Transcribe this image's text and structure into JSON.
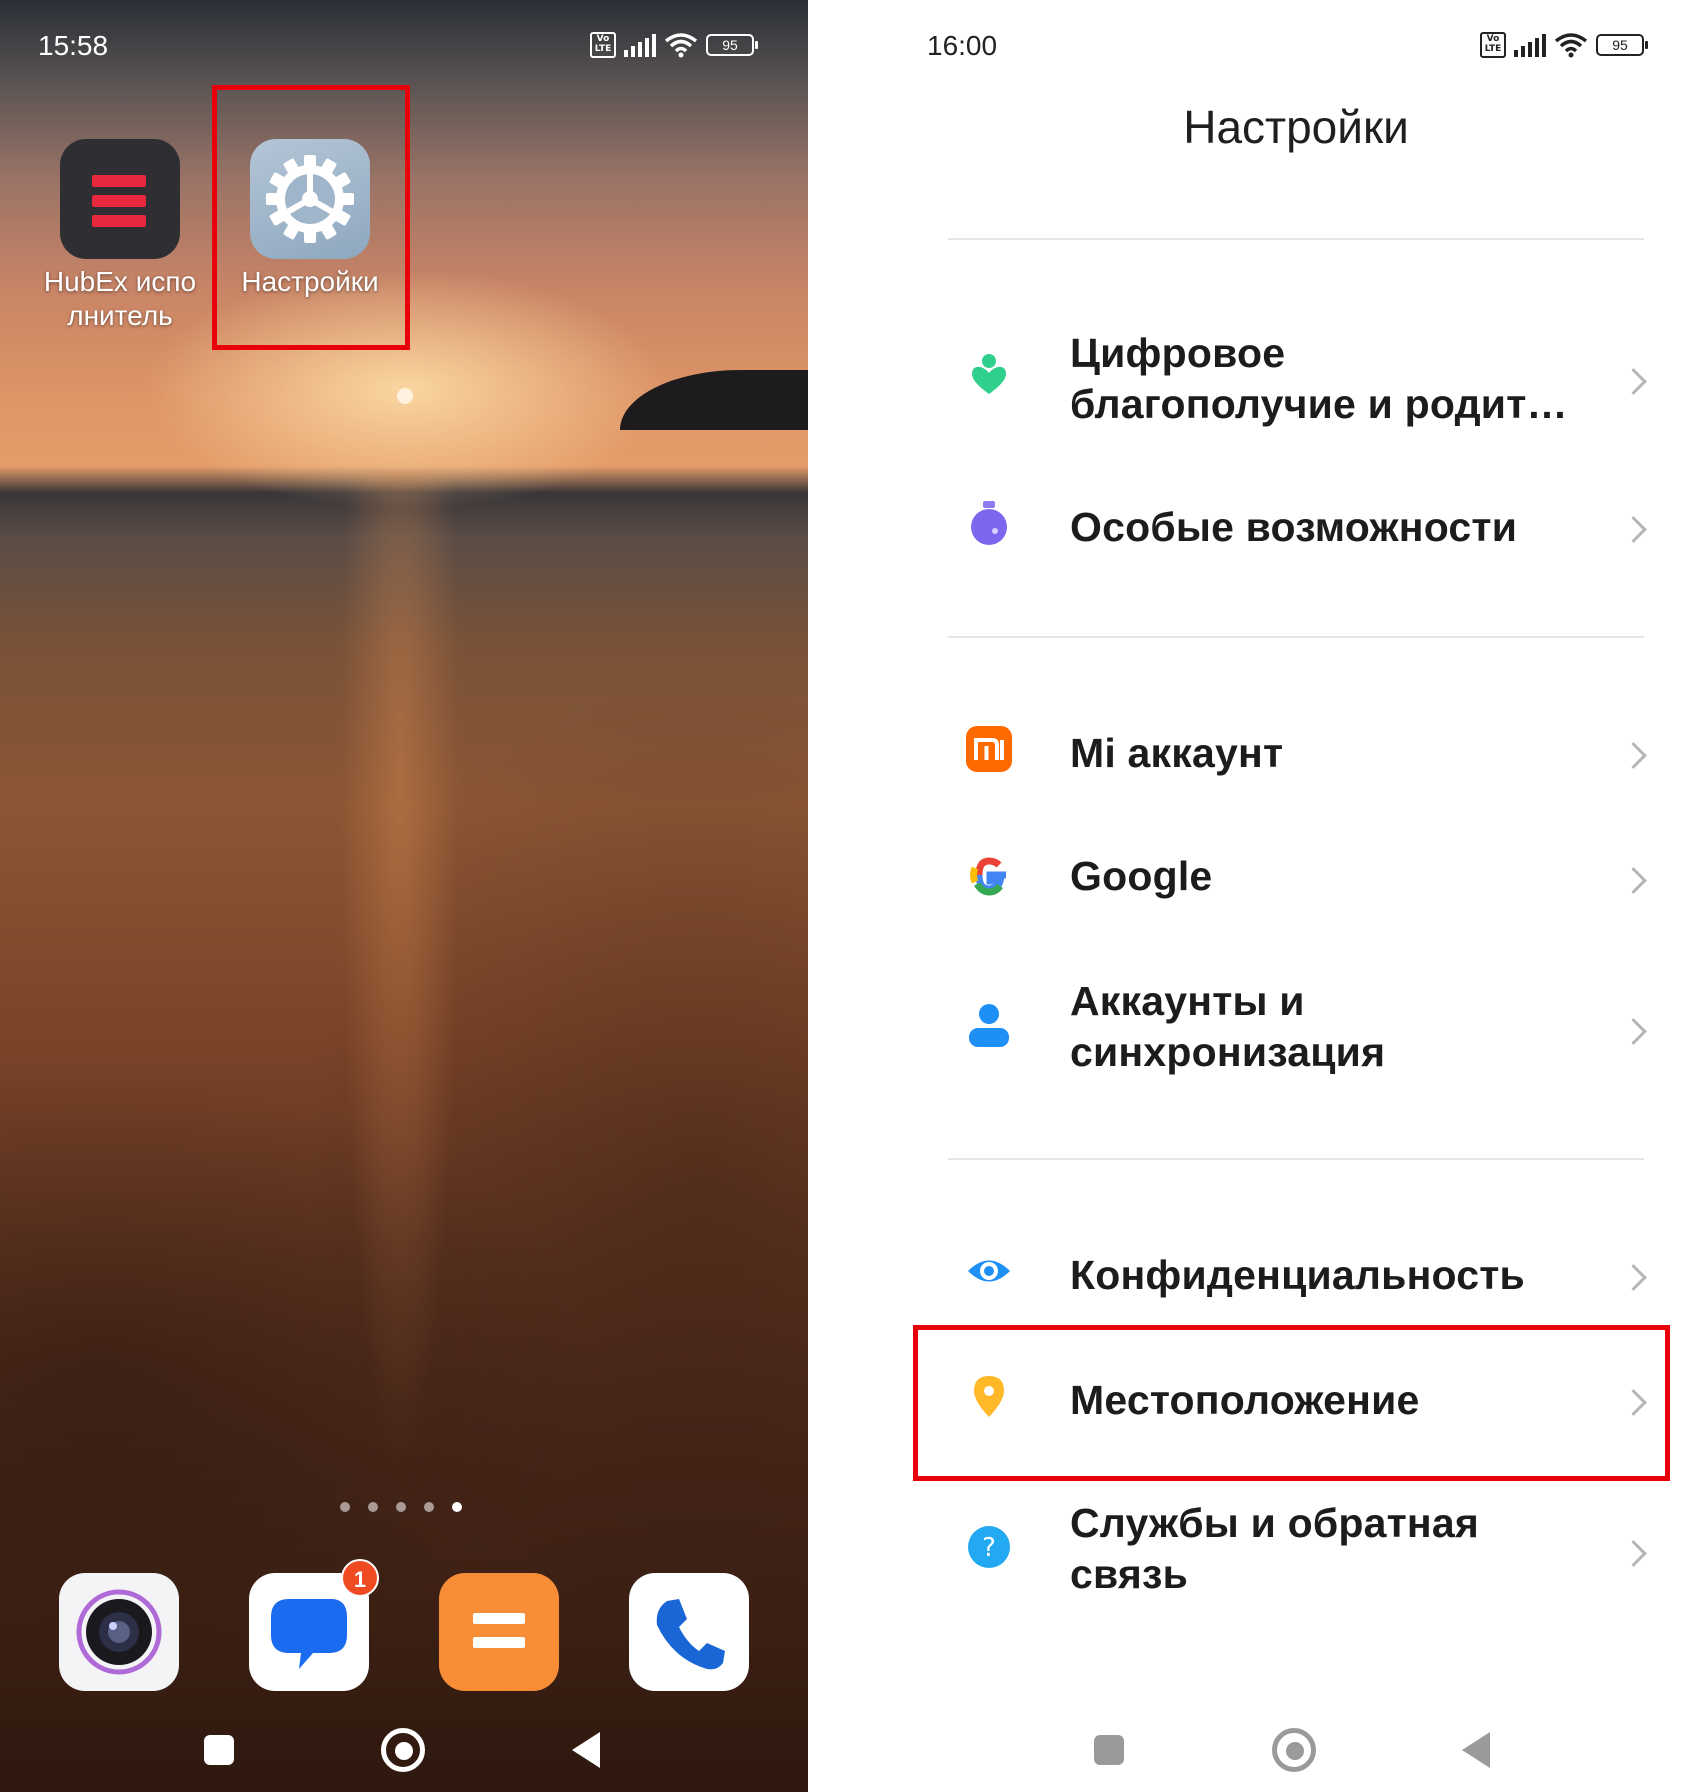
{
  "colors": {
    "highlight": "#e8000b",
    "hubex_red": "#e8283c",
    "badge": "#f04a23"
  },
  "left_phone": {
    "status": {
      "time": "15:58",
      "lte": "Vo LTE",
      "battery": "95"
    },
    "apps": [
      {
        "label": "HubEx испо лнитель",
        "icon": "hubex-icon"
      },
      {
        "label": "Настройки",
        "icon": "settings-gear-icon"
      }
    ],
    "page_dots": {
      "count": 5,
      "active": 5
    },
    "dock": [
      {
        "icon": "camera-icon"
      },
      {
        "icon": "messages-icon",
        "badge": "1"
      },
      {
        "icon": "orange-equals-icon"
      },
      {
        "icon": "phone-icon"
      }
    ]
  },
  "right_phone": {
    "status": {
      "time": "16:00",
      "lte": "Vo LTE",
      "battery": "95"
    },
    "title": "Настройки",
    "items": [
      {
        "label": "Цифровое благополучие и родит…",
        "icon": "wellbeing-icon"
      },
      {
        "label": "Особые возможности",
        "icon": "accessibility-icon"
      },
      {
        "label": "Mi аккаунт",
        "icon": "mi-account-icon"
      },
      {
        "label": "Google",
        "icon": "google-icon"
      },
      {
        "label": "Аккаунты и синхронизация",
        "icon": "accounts-icon"
      },
      {
        "label": "Конфиденциальность",
        "icon": "privacy-eye-icon"
      },
      {
        "label": "Местоположение",
        "icon": "location-pin-icon"
      },
      {
        "label": "Службы и обратная связь",
        "icon": "help-icon"
      }
    ]
  }
}
